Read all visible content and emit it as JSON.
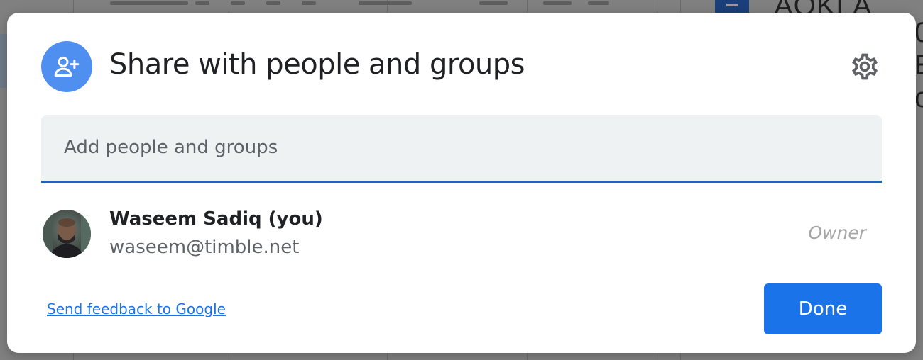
{
  "dialog": {
    "title": "Share with people and groups",
    "header_icon": "person-add-icon",
    "settings_icon": "gear-icon",
    "search": {
      "placeholder": "Add people and groups",
      "value": ""
    },
    "people": [
      {
        "name": "Waseem Sadiq (you)",
        "email": "waseem@timble.net",
        "role": "Owner"
      }
    ],
    "feedback_link": "Send feedback to Google",
    "done_label": "Done"
  },
  "colors": {
    "accent": "#1a73e8",
    "header_avatar": "#4f8ff0",
    "search_bg": "#eef2f3",
    "search_underline": "#1a63c9",
    "role_text": "#a6a6a6"
  }
}
